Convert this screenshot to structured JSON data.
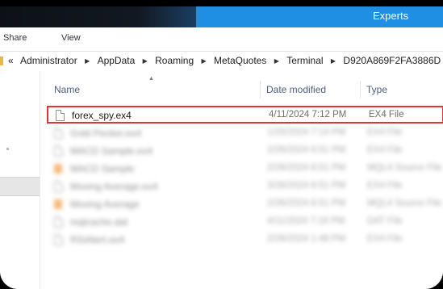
{
  "window": {
    "title": "Experts"
  },
  "ribbon": {
    "tabs": [
      "Share",
      "View"
    ]
  },
  "address": {
    "path": [
      "Administrator",
      "AppData",
      "Roaming",
      "MetaQuotes",
      "Terminal",
      "D920A869F2FA3886D"
    ],
    "prefix": "«"
  },
  "columns": {
    "name": "Name",
    "date": "Date modified",
    "type": "Type"
  },
  "files": [
    {
      "name": "forex_spy.ex4",
      "date": "4/11/2024 7:12 PM",
      "type": "EX4 File",
      "icon": "file-icon",
      "highlighted": true,
      "blurred": false
    },
    {
      "name": "Gold Pecker.ex4",
      "date": "1/25/2024 7:14 PM",
      "type": "EX4 File",
      "icon": "file-icon",
      "highlighted": false,
      "blurred": true
    },
    {
      "name": "MACD Sample.ex4",
      "date": "2/26/2024 6:51 PM",
      "type": "EX4 File",
      "icon": "file-icon",
      "highlighted": false,
      "blurred": true
    },
    {
      "name": "MACD Sample",
      "date": "2/26/2024 6:51 PM",
      "type": "MQL4 Source File",
      "icon": "source-file-icon",
      "highlighted": false,
      "blurred": true
    },
    {
      "name": "Moving Average.ex4",
      "date": "3/26/2024 6:51 PM",
      "type": "EX4 File",
      "icon": "file-icon",
      "highlighted": false,
      "blurred": true
    },
    {
      "name": "Moving Average",
      "date": "2/26/2024 6:51 PM",
      "type": "MQL4 Source File",
      "icon": "source-file-icon",
      "highlighted": false,
      "blurred": true
    },
    {
      "name": "mqlcache.dat",
      "date": "4/11/2024 7:16 PM",
      "type": "DAT File",
      "icon": "file-icon",
      "highlighted": false,
      "blurred": true
    },
    {
      "name": "RSIAlert.ex4",
      "date": "2/26/2024 1:48 PM",
      "type": "EX4 File",
      "icon": "file-icon",
      "highlighted": false,
      "blurred": true
    }
  ],
  "colors": {
    "titlebar": "#1f8fe3",
    "highlight_border": "#e23434",
    "header_text": "#4d6082",
    "source_icon": "#f0a04b"
  }
}
